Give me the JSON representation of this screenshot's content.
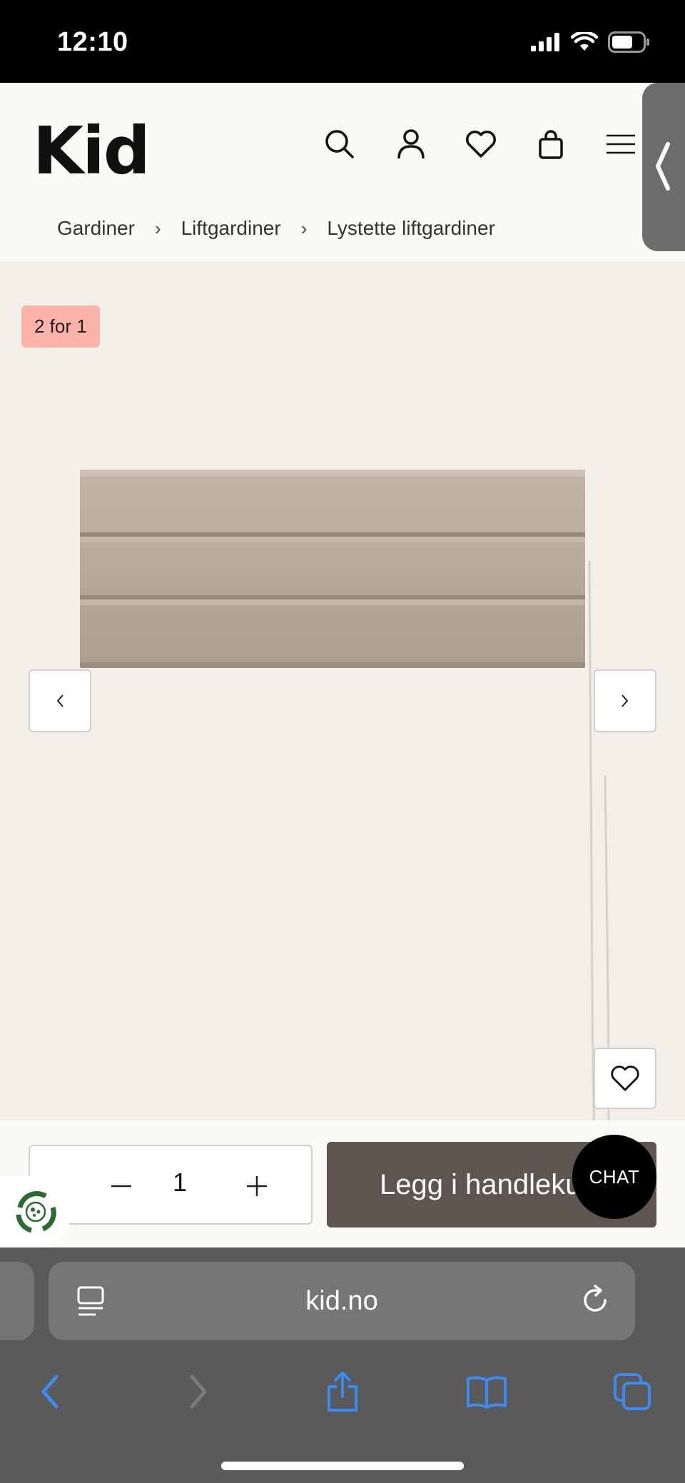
{
  "status_bar": {
    "time": "12:10"
  },
  "header": {
    "logo": "Kid",
    "breadcrumb": [
      "Gardiner",
      "Liftgardiner",
      "Lystette liftgardiner"
    ],
    "breadcrumb_separator": "›"
  },
  "product": {
    "promo_badge": "2 for 1",
    "icons": {
      "prev": "chevron-left-icon",
      "next": "chevron-right-icon",
      "favorite": "heart-icon"
    }
  },
  "purchase": {
    "quantity": "1",
    "add_to_cart_label": "Legg i handlekurv",
    "chat_label": "CHAT"
  },
  "browser": {
    "url": "kid.no"
  },
  "colors": {
    "header_bg": "#fbfaf6",
    "product_bg": "#f2efe9",
    "badge_bg": "#fcb3a9",
    "add_button_bg": "#5e5550",
    "safari_blue": "#3d8bf2"
  }
}
